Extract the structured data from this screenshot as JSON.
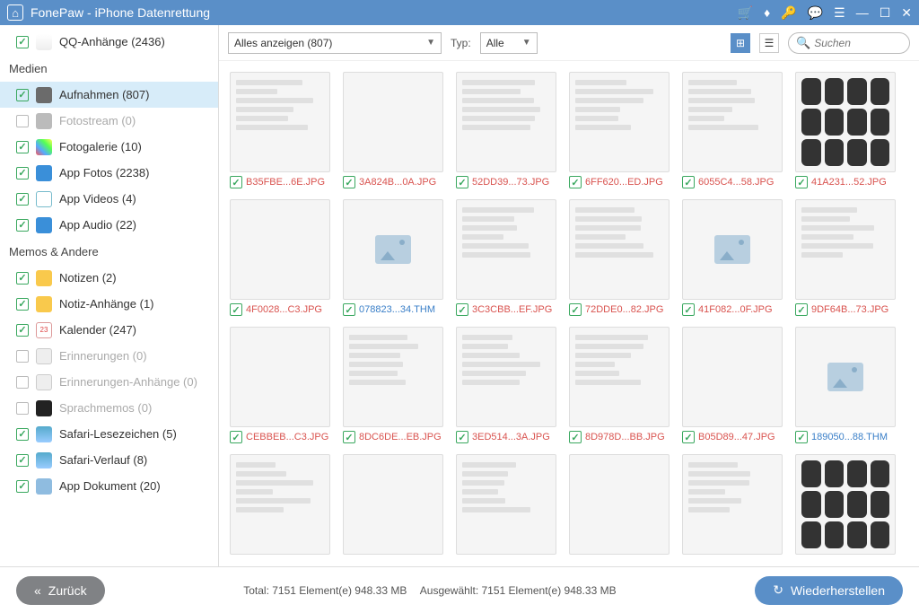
{
  "title": "FonePaw - iPhone Datenrettung",
  "sidebar": {
    "top": {
      "label": "QQ-Anhänge (2436)",
      "checked": true
    },
    "sections": [
      {
        "header": "Medien",
        "items": [
          {
            "label": "Aufnahmen (807)",
            "checked": true,
            "sel": true,
            "ic": "i-cam"
          },
          {
            "label": "Fotostream (0)",
            "checked": false,
            "dim": true,
            "ic": "i-camg"
          },
          {
            "label": "Fotogalerie (10)",
            "checked": true,
            "ic": "i-gal"
          },
          {
            "label": "App Fotos (2238)",
            "checked": true,
            "ic": "i-af"
          },
          {
            "label": "App Videos (4)",
            "checked": true,
            "ic": "i-av"
          },
          {
            "label": "App Audio (22)",
            "checked": true,
            "ic": "i-aa"
          }
        ]
      },
      {
        "header": "Memos & Andere",
        "items": [
          {
            "label": "Notizen (2)",
            "checked": true,
            "ic": "i-not"
          },
          {
            "label": "Notiz-Anhänge (1)",
            "checked": true,
            "ic": "i-not"
          },
          {
            "label": "Kalender (247)",
            "checked": true,
            "ic": "i-cal"
          },
          {
            "label": "Erinnerungen (0)",
            "checked": false,
            "dim": true,
            "ic": "i-rem"
          },
          {
            "label": "Erinnerungen-Anhänge (0)",
            "checked": false,
            "dim": true,
            "ic": "i-rem"
          },
          {
            "label": "Sprachmemos (0)",
            "checked": false,
            "dim": true,
            "ic": "i-vm"
          },
          {
            "label": "Safari-Lesezeichen (5)",
            "checked": true,
            "ic": "i-bm"
          },
          {
            "label": "Safari-Verlauf (8)",
            "checked": true,
            "ic": "i-bm"
          },
          {
            "label": "App Dokument (20)",
            "checked": true,
            "ic": "i-doc"
          }
        ]
      }
    ]
  },
  "toolbar": {
    "filter": "Alles anzeigen (807)",
    "typeLabel": "Typ:",
    "typeValue": "Alle",
    "searchPlaceholder": "Suchen"
  },
  "thumbs": [
    {
      "fn": "B35FBE...6E.JPG",
      "v": "tv-a",
      "lines": 1
    },
    {
      "fn": "3A824B...0A.JPG",
      "v": "tv-b"
    },
    {
      "fn": "52DD39...73.JPG",
      "v": "tv-c",
      "lines": 1
    },
    {
      "fn": "6FF620...ED.JPG",
      "v": "tv-d",
      "lines": 1
    },
    {
      "fn": "6055C4...58.JPG",
      "v": "tv-a",
      "lines": 1
    },
    {
      "fn": "41A231...52.JPG",
      "v": "tv-e",
      "ctrl": 1
    },
    {
      "fn": "4F0028...C3.JPG",
      "v": "tv-f"
    },
    {
      "fn": "078823...34.THM",
      "v": "tv-g",
      "ph": 1,
      "blue": 1
    },
    {
      "fn": "3C3CBB...EF.JPG",
      "v": "tv-a",
      "lines": 1
    },
    {
      "fn": "72DDE0...82.JPG",
      "v": "tv-h",
      "lines": 1
    },
    {
      "fn": "41F082...0F.JPG",
      "v": "tv-g",
      "ph": 1
    },
    {
      "fn": "9DF64B...73.JPG",
      "v": "tv-a",
      "lines": 1
    },
    {
      "fn": "CEBBEB...C3.JPG",
      "v": "tv-k"
    },
    {
      "fn": "8DC6DE...EB.JPG",
      "v": "tv-a",
      "lines": 1
    },
    {
      "fn": "3ED514...3A.JPG",
      "v": "tv-a",
      "lines": 1
    },
    {
      "fn": "8D978D...BB.JPG",
      "v": "tv-d",
      "lines": 1
    },
    {
      "fn": "B05D89...47.JPG",
      "v": "tv-i"
    },
    {
      "fn": "189050...88.THM",
      "v": "tv-g",
      "ph": 1,
      "blue": 1
    },
    {
      "fn": "",
      "v": "tv-a",
      "lines": 1,
      "nocap": 1
    },
    {
      "fn": "",
      "v": "tv-k",
      "nocap": 1
    },
    {
      "fn": "",
      "v": "tv-a",
      "lines": 1,
      "nocap": 1
    },
    {
      "fn": "",
      "v": "tv-j",
      "nocap": 1
    },
    {
      "fn": "",
      "v": "tv-a",
      "lines": 1,
      "nocap": 1
    },
    {
      "fn": "",
      "v": "tv-e",
      "ctrl": 1,
      "nocap": 1
    }
  ],
  "footer": {
    "back": "Zurück",
    "total": "Total: 7151 Element(e) 948.33 MB",
    "selected": "Ausgewählt: 7151 Element(e) 948.33 MB",
    "recover": "Wiederherstellen"
  },
  "calText": "23"
}
